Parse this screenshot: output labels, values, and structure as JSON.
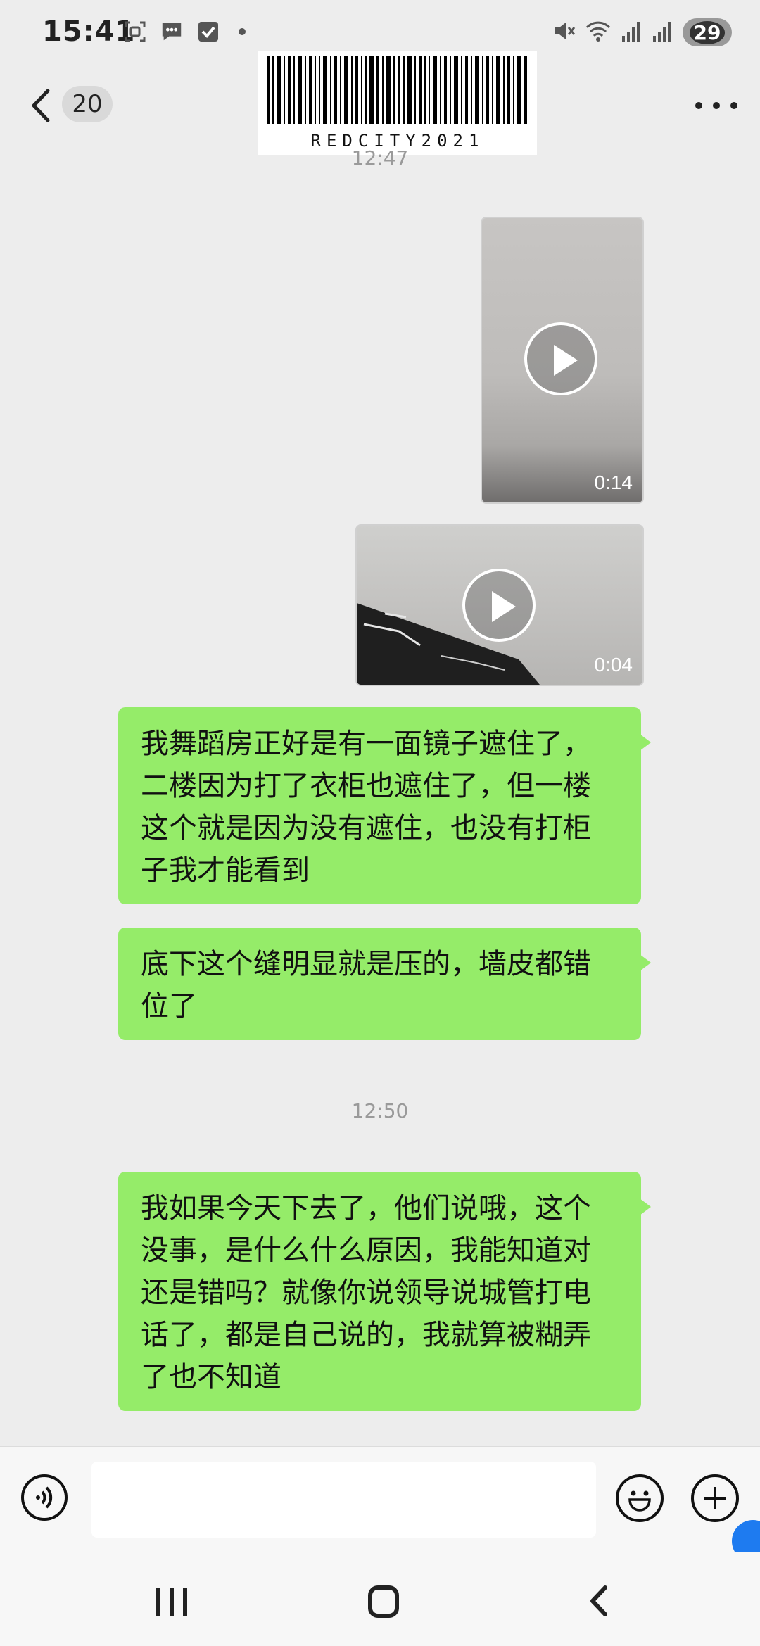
{
  "status_bar": {
    "time": "15:41",
    "battery": "29",
    "left_icons": [
      "screenshot-icon",
      "chat-bubble-icon",
      "checkbox-icon"
    ],
    "right_icons": [
      "mute-icon",
      "wifi-icon",
      "signal-icon",
      "signal-icon-2"
    ]
  },
  "header": {
    "unread_count": "20",
    "watermark_text": "REDCITY2021"
  },
  "messages": {
    "timestamp_1": "12:47",
    "video_1_duration": "0:14",
    "video_2_duration": "0:04",
    "text_1": "我舞蹈房正好是有一面镜子遮住了，二楼因为打了衣柜也遮住了，但一楼这个就是因为没有遮住，也没有打柜子我才能看到",
    "text_2": "底下这个缝明显就是压的，墙皮都错位了",
    "timestamp_2": "12:50",
    "text_3": "我如果今天下去了，他们说哦，这个没事，是什么什么原因，我能知道对还是错吗？就像你说领导说城管打电话了，都是自己说的，我就算被糊弄了也不知道"
  },
  "input_bar": {
    "placeholder": ""
  },
  "colors": {
    "bubble": "#95ec69",
    "background": "#ededed"
  }
}
